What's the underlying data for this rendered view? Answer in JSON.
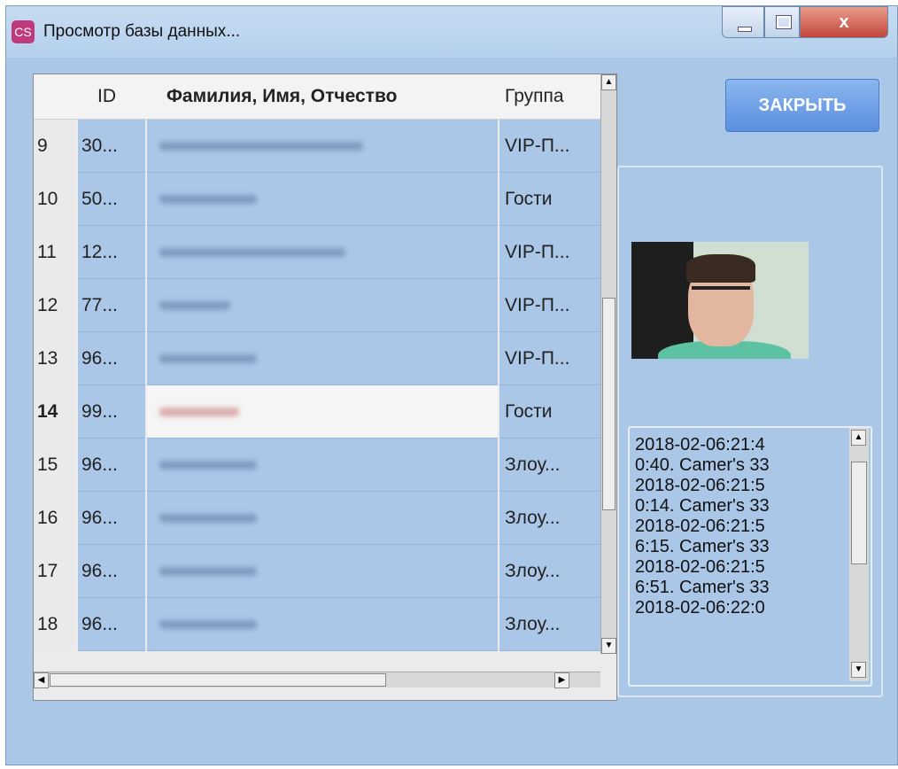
{
  "window": {
    "title": "Просмотр базы данных...",
    "app_icon": "app-logo-icon",
    "close_glyph": "x"
  },
  "table": {
    "columns": [
      "",
      "ID",
      "Фамилия, Имя, Отчество",
      "Группа"
    ],
    "rows": [
      {
        "num": "9",
        "id": "30...",
        "group": "VIP-П..."
      },
      {
        "num": "10",
        "id": "50...",
        "group": "Гости"
      },
      {
        "num": "11",
        "id": "12...",
        "group": "VIP-П..."
      },
      {
        "num": "12",
        "id": "77...",
        "group": "VIP-П..."
      },
      {
        "num": "13",
        "id": "96...",
        "group": "VIP-П..."
      },
      {
        "num": "14",
        "id": "99...",
        "group": "Гости"
      },
      {
        "num": "15",
        "id": "96...",
        "group": "Злоу..."
      },
      {
        "num": "16",
        "id": "96...",
        "group": "Злоу..."
      },
      {
        "num": "17",
        "id": "96...",
        "group": "Злоу..."
      },
      {
        "num": "18",
        "id": "96...",
        "group": "Злоу..."
      }
    ],
    "current_row": "14"
  },
  "buttons": {
    "close_label": "ЗАКРЫТЬ"
  },
  "log": {
    "text": "2018-02-06:21:4\n0:40. Camer's 33\n2018-02-06:21:5\n0:14. Camer's 33\n2018-02-06:21:5\n6:15. Camer's 33\n2018-02-06:21:5\n6:51. Camer's 33\n2018-02-06:22:0"
  },
  "colors": {
    "window_bg": "#aac7e8",
    "accent_button": "#5a8ee0",
    "close_red": "#c2473a"
  }
}
